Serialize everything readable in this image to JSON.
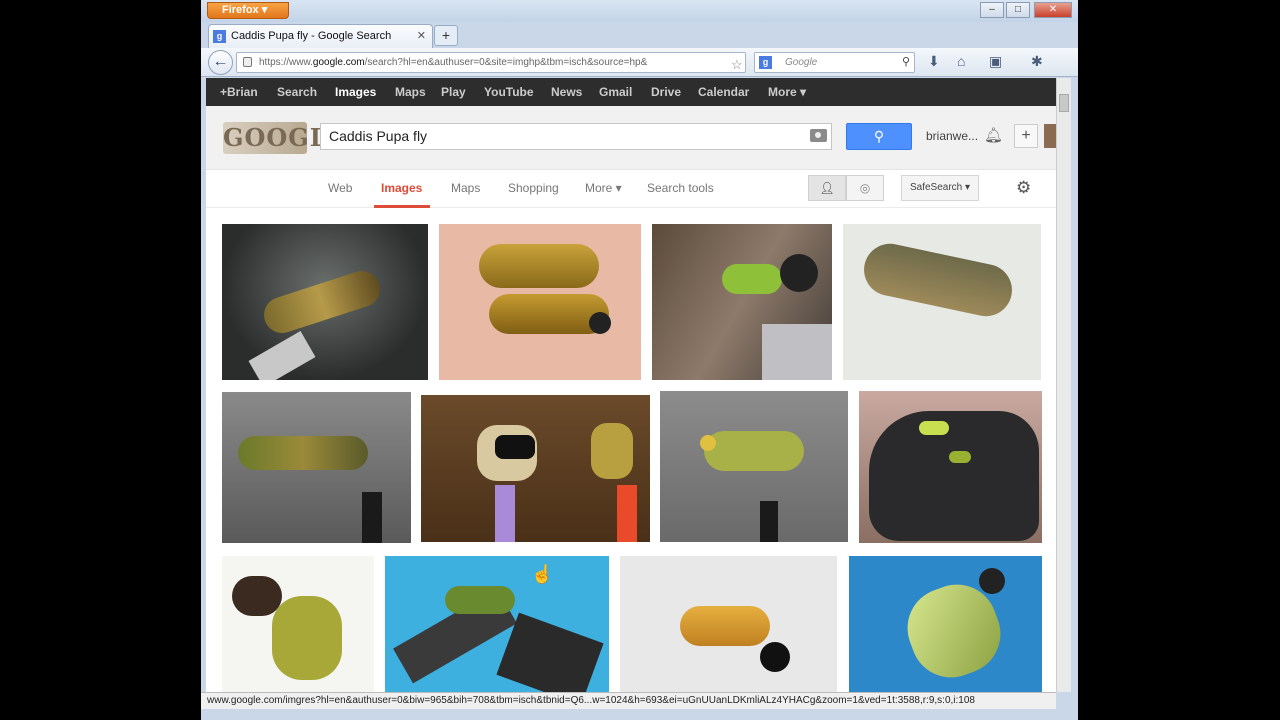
{
  "browser": {
    "menu_label": "Firefox",
    "tab_title": "Caddis Pupa fly - Google Search",
    "tab_favicon": "g",
    "url_prefix": "https://www.",
    "url_domain": "google.com",
    "url_rest": "/search?hl=en&authuser=0&site=imghp&tbm=isch&source=hp&",
    "search_placeholder": "Google",
    "status_url": "www.google.com/imgres?hl=en&authuser=0&biw=965&bih=708&tbm=isch&tbnid=Q6...w=1024&h=693&ei=uGnUUanLDKmliALz4YHACg&zoom=1&ved=1t:3588,r:9,s:0,i:108"
  },
  "google_bar": [
    "+Brian",
    "Search",
    "Images",
    "Maps",
    "Play",
    "YouTube",
    "News",
    "Gmail",
    "Drive",
    "Calendar",
    "More ▾"
  ],
  "header": {
    "logo_text": "GOOGLE",
    "query": "Caddis Pupa fly",
    "user": "brianwe...",
    "plus": "+"
  },
  "search_tabs": [
    "Web",
    "Images",
    "Maps",
    "Shopping",
    "More ▾",
    "Search tools"
  ],
  "safe_search": "SafeSearch ▾",
  "icons": {
    "back": "back-arrow-icon",
    "lock": "lock-icon",
    "star": "star-icon",
    "reload": "reload-icon",
    "download": "download-icon",
    "home": "home-icon",
    "bell": "bell-icon",
    "gear": "gear-icon",
    "camera": "camera-icon",
    "search": "magnifier-icon"
  },
  "colors": {
    "google_blue": "#4d90fe",
    "active_tab_red": "#dd4b39",
    "gbar_bg": "#2d2d2d"
  }
}
